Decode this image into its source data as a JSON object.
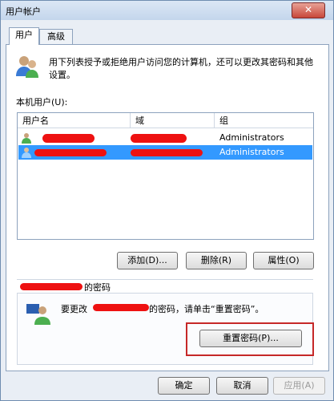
{
  "window": {
    "title": "用户帐户",
    "close_glyph": "✕"
  },
  "tabs": [
    {
      "label": "用户",
      "active": true
    },
    {
      "label": "高级",
      "active": false
    }
  ],
  "intro_text": "用下列表授予或拒绝用户访问您的计算机，还可以更改其密码和其他设置。",
  "local_users_label": "本机用户(U):",
  "table": {
    "columns": [
      "用户名",
      "域",
      "组"
    ],
    "rows": [
      {
        "username": "",
        "domain": "",
        "group": "Administrators",
        "selected": false
      },
      {
        "username": "",
        "domain": "",
        "group": "Administrators",
        "selected": true
      }
    ]
  },
  "buttons": {
    "add": "添加(D)...",
    "remove": "删除(R)",
    "properties": "属性(O)"
  },
  "password": {
    "section_title_suffix": "的密码",
    "prefix": "要更改",
    "suffix": "的密码，请单击“重置密码”。",
    "reset_button": "重置密码(P)..."
  },
  "footer": {
    "ok": "确定",
    "cancel": "取消",
    "apply": "应用(A)"
  },
  "colors": {
    "selection": "#3399ff",
    "redaction": "#ee1111",
    "highlight": "#c62828"
  }
}
